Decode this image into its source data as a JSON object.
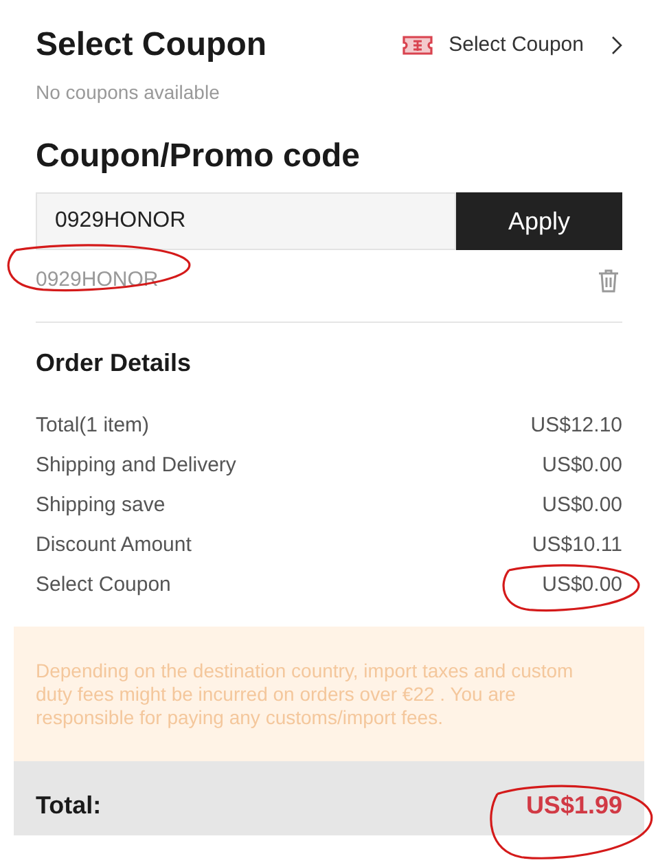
{
  "coupon_section": {
    "title": "Select Coupon",
    "link_label": "Select Coupon",
    "subtitle": "No coupons available"
  },
  "promo": {
    "title": "Coupon/Promo code",
    "value": "0929HONOR",
    "button": "Apply",
    "applied_code": "0929HONOR"
  },
  "order_details": {
    "title": "Order Details",
    "rows": [
      {
        "label": "Total(1 item)",
        "value": "US$12.10"
      },
      {
        "label": "Shipping and Delivery",
        "value": "US$0.00"
      },
      {
        "label": "Shipping save",
        "value": "US$0.00"
      },
      {
        "label": "Discount Amount",
        "value": "US$10.11"
      },
      {
        "label": "Select Coupon",
        "value": "US$0.00"
      }
    ]
  },
  "notice": "Depending on the destination country, import taxes and custom duty fees might be incurred on orders over €22 . You are responsible for paying any customs/import fees.",
  "total": {
    "label": "Total:",
    "value": "US$1.99"
  }
}
